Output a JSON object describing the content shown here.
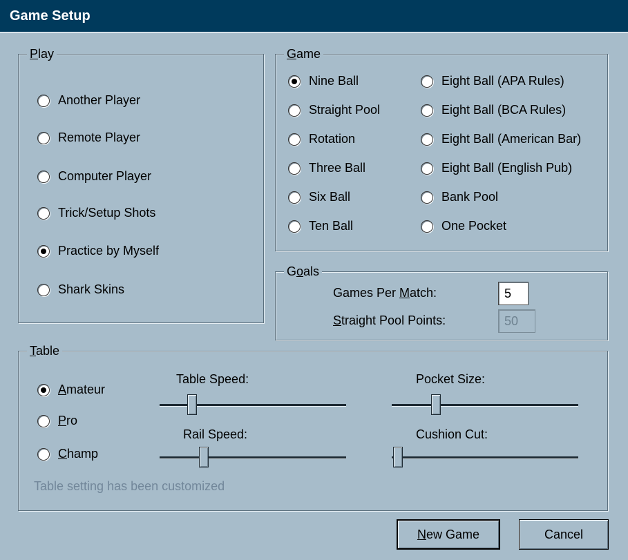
{
  "window": {
    "title": "Game Setup"
  },
  "play": {
    "legend_key": "P",
    "legend_rest": "lay",
    "options": [
      {
        "label": "Another Player",
        "selected": false
      },
      {
        "label": "Remote Player",
        "selected": false
      },
      {
        "label": "Computer Player",
        "selected": false
      },
      {
        "label": "Trick/Setup Shots",
        "selected": false
      },
      {
        "label": "Practice by Myself",
        "selected": true
      },
      {
        "label": "Shark Skins",
        "selected": false
      }
    ]
  },
  "game": {
    "legend_key": "G",
    "legend_rest": "ame",
    "left_options": [
      {
        "label": "Nine Ball",
        "selected": true
      },
      {
        "label": "Straight Pool",
        "selected": false
      },
      {
        "label": "Rotation",
        "selected": false
      },
      {
        "label": "Three Ball",
        "selected": false
      },
      {
        "label": "Six Ball",
        "selected": false
      },
      {
        "label": "Ten Ball",
        "selected": false
      }
    ],
    "right_options": [
      {
        "label": "Eight Ball (APA Rules)",
        "selected": false
      },
      {
        "label": "Eight Ball (BCA Rules)",
        "selected": false
      },
      {
        "label": "Eight Ball (American Bar)",
        "selected": false
      },
      {
        "label": "Eight Ball (English Pub)",
        "selected": false
      },
      {
        "label": "Bank Pool",
        "selected": false
      },
      {
        "label": "One Pocket",
        "selected": false
      }
    ]
  },
  "goals": {
    "legend_pre": "G",
    "legend_key": "o",
    "legend_rest": "als",
    "games_per_match_pre": "Games Per ",
    "games_per_match_key": "M",
    "games_per_match_rest": "atch:",
    "games_per_match_value": "5",
    "straight_pool_key": "S",
    "straight_pool_rest": "traight Pool Points:",
    "straight_pool_value": "50"
  },
  "table": {
    "legend_key": "T",
    "legend_rest": "able",
    "levels": [
      {
        "key": "A",
        "rest": "mateur",
        "selected": true
      },
      {
        "key": "P",
        "rest": "ro",
        "selected": false
      },
      {
        "key": "C",
        "rest": "hamp",
        "selected": false
      }
    ],
    "sliders": {
      "table_speed": {
        "label": "Table Speed:",
        "value": 0.15
      },
      "pocket_size": {
        "label": "Pocket Size:",
        "value": 0.22
      },
      "rail_speed": {
        "label": "Rail Speed:",
        "value": 0.22
      },
      "cushion_cut": {
        "label": "Cushion Cut:",
        "value": 0.0
      }
    },
    "note": "Table setting has been customized"
  },
  "buttons": {
    "new_game_key": "N",
    "new_game_rest": "ew Game",
    "cancel": "Cancel"
  },
  "colors": {
    "dialog_bg": "#a7bcca",
    "titlebar_bg": "#003a5c",
    "titlebar_text": "#ffffff",
    "disabled_text": "#72879a"
  }
}
